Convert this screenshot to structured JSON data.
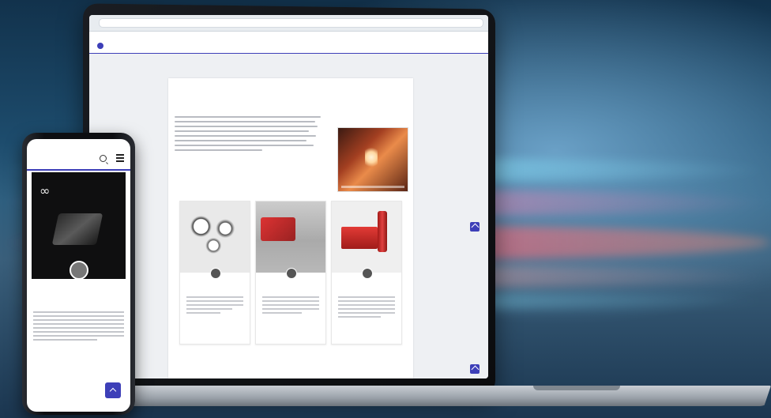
{
  "colors": {
    "accent": "#3d3fb8",
    "laptop_frame": "#0b0c0e",
    "phone_frame": "#0d0e11"
  },
  "laptop": {
    "browser": {
      "url": "",
      "tab_title": ""
    },
    "site": {
      "logo": "",
      "nav": []
    },
    "article": {
      "breadcrumbs": "",
      "title": "",
      "more_label": ""
    },
    "cards": [
      {
        "title": ""
      },
      {
        "title": ""
      },
      {
        "title": ""
      }
    ]
  },
  "phone": {
    "status_time": "",
    "logo": "",
    "hero_brand": "",
    "headline": "",
    "footer_label": ""
  }
}
